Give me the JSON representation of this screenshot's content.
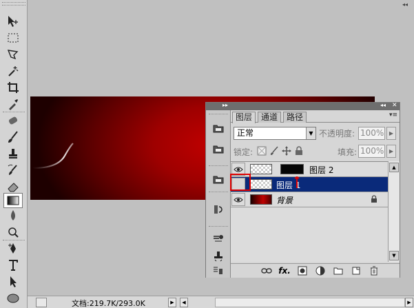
{
  "panel": {
    "tabs": [
      {
        "label": "图层",
        "active": true
      },
      {
        "label": "通道",
        "active": false
      },
      {
        "label": "路径",
        "active": false
      }
    ],
    "menu_icon": "panel-menu-icon",
    "blend_mode": "正常",
    "opacity_label": "不透明度:",
    "opacity_value": "100%",
    "lock_label": "锁定:",
    "fill_label": "填充:",
    "fill_value": "100%",
    "layers": [
      {
        "name": "图层 2",
        "visible": true,
        "selected": false,
        "has_mask": true
      },
      {
        "name": "图层 1",
        "visible": false,
        "selected": true,
        "has_mask": false
      },
      {
        "name": "背景",
        "visible": true,
        "selected": false,
        "locked": true
      }
    ],
    "bottom_icons": [
      "link-icon",
      "fx-icon",
      "mask-icon",
      "adjustment-icon",
      "folder-icon",
      "new-layer-icon",
      "trash-icon"
    ]
  },
  "status": {
    "doc_info": "文档:219.7K/293.0K"
  },
  "colors": {
    "selection": "#0a2a7a",
    "annotation": "#e00000"
  }
}
